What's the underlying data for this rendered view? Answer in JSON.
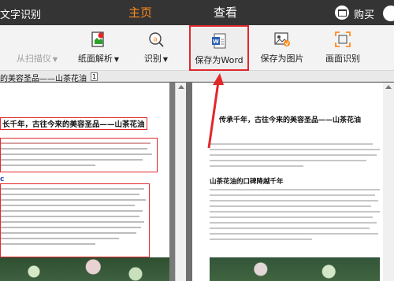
{
  "app": {
    "title": "文字识别"
  },
  "nav": {
    "home": "主页",
    "view": "查看",
    "buy": "购买"
  },
  "toolbar": {
    "scan": "从扫描仪",
    "pdf_parse": "纸面解析",
    "recognize": "识别",
    "save_word": "保存为Word",
    "save_image": "保存为图片",
    "screen_recognize": "画面识别"
  },
  "doc": {
    "tab_title": "的美容圣品——山茶花油",
    "tab_count": "1",
    "left_heading": "长千年，古往今来的美容圣品——山茶花油",
    "left_subhead": "c",
    "right_heading": "传承千年，古往今来的美容圣品——山茶花油",
    "right_subhead": "山茶花油的口碑降越千年"
  },
  "colors": {
    "accent": "#ff8a1e",
    "highlight": "#e2272b",
    "topbar": "#343434"
  }
}
